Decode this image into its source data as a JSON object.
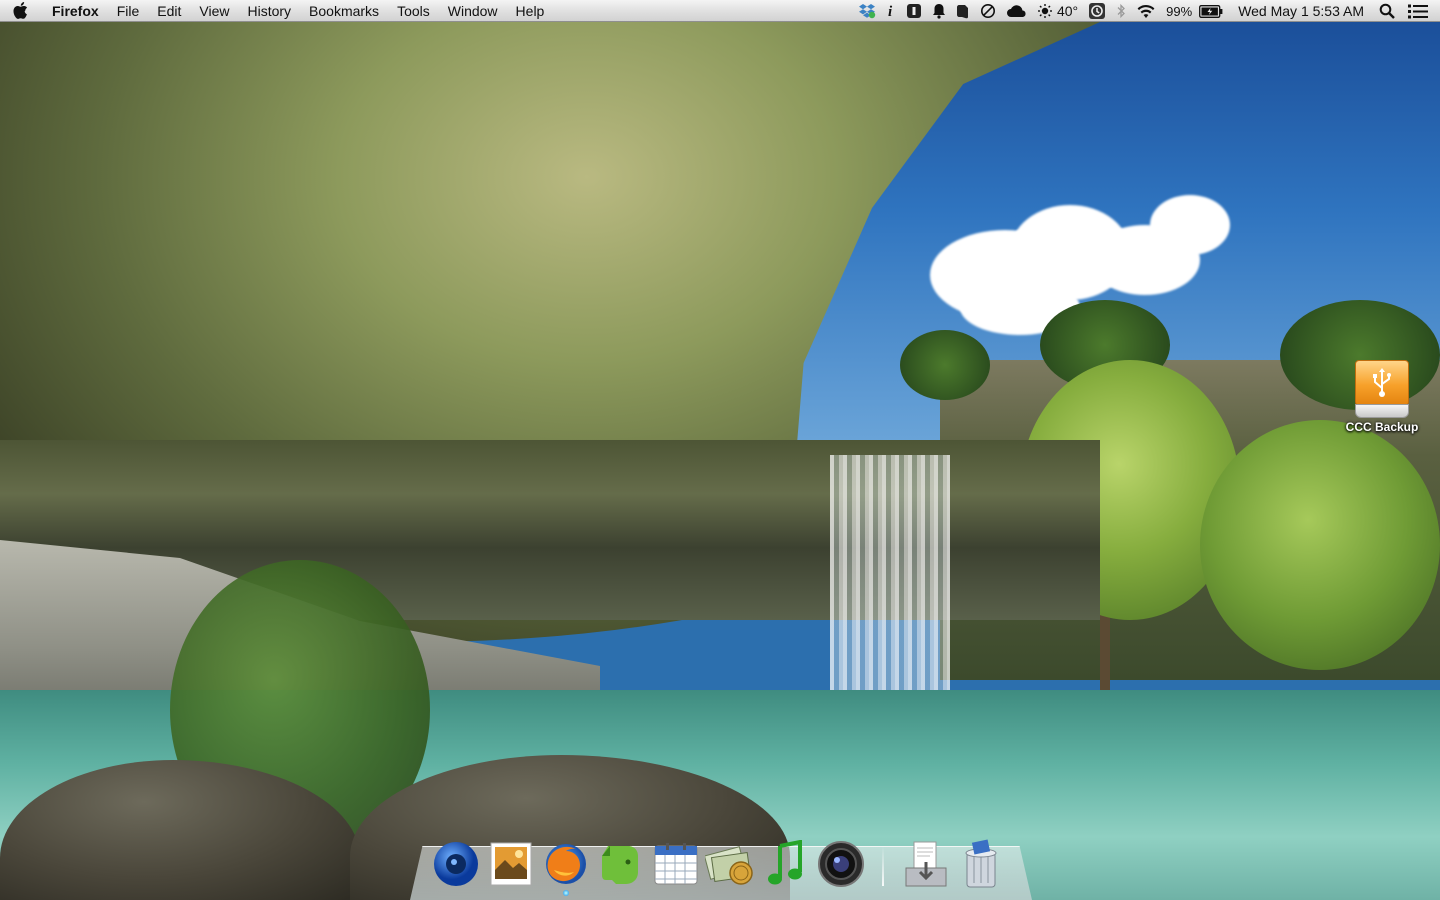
{
  "menubar": {
    "app_name": "Firefox",
    "menus": [
      "File",
      "Edit",
      "View",
      "History",
      "Bookmarks",
      "Tools",
      "Window",
      "Help"
    ],
    "status": {
      "icons": [
        "dropbox-icon",
        "info-icon",
        "one-password-icon",
        "notification-bell-icon",
        "evernote-helper-icon",
        "do-not-disturb-icon",
        "cloud-icon",
        "weather-sun-icon"
      ],
      "temperature": "40°",
      "more_icons": [
        "time-machine-icon",
        "bluetooth-icon",
        "wifi-icon"
      ],
      "battery_percent": "99%",
      "clock": "Wed May 1  5:53 AM",
      "end_icons": [
        "spotlight-icon",
        "notification-center-icon"
      ]
    }
  },
  "desktop": {
    "icons": [
      {
        "label": "CCC Backup",
        "icon": "usb-drive-icon"
      }
    ]
  },
  "dock": {
    "apps": [
      {
        "name": "Camino",
        "icon": "blue-globe-eye-icon",
        "running": false
      },
      {
        "name": "Preview",
        "icon": "preview-stamp-icon",
        "running": false
      },
      {
        "name": "Firefox",
        "icon": "firefox-icon",
        "running": true
      },
      {
        "name": "Evernote",
        "icon": "evernote-elephant-icon",
        "running": false
      },
      {
        "name": "Calendar",
        "icon": "calendar-icon",
        "running": false
      },
      {
        "name": "Money",
        "icon": "money-coins-icon",
        "running": false
      },
      {
        "name": "Music",
        "icon": "music-note-icon",
        "running": false
      },
      {
        "name": "Camera",
        "icon": "camera-lens-icon",
        "running": false
      }
    ],
    "stacks": [
      {
        "name": "Downloads",
        "icon": "downloads-tray-icon"
      },
      {
        "name": "Trash",
        "icon": "trash-can-icon"
      }
    ]
  }
}
